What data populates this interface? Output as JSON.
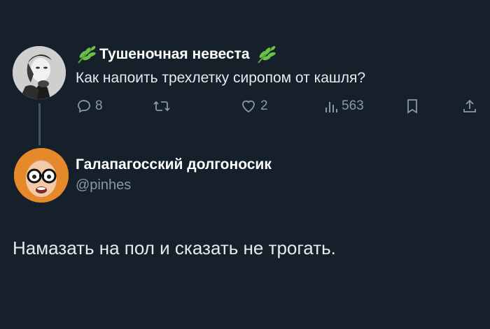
{
  "parent_tweet": {
    "author_name": "Тушеночная невеста",
    "text": "Как напоить трехлетку сиропом от кашля?",
    "name_decoration_icon": "plant-leaf-icon",
    "actions": {
      "reply_count": "8",
      "retweet_count": "",
      "like_count": "2",
      "view_count": "563"
    }
  },
  "reply_tweet": {
    "author_name": "Галапагосский долгоносик",
    "handle": "@pinhes",
    "text": "Намазать на пол и сказать не трогать."
  },
  "colors": {
    "background": "#15202b",
    "text_primary": "#e7e9ea",
    "text_secondary": "#8b98a5",
    "thread_line": "#3d5466",
    "leaf_green": "#6bbf4a"
  }
}
